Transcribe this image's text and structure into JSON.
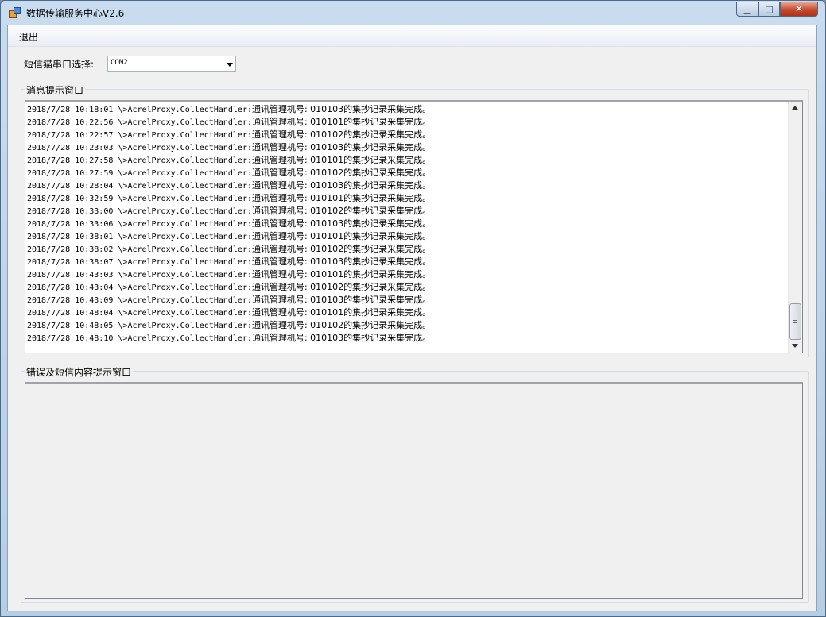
{
  "window": {
    "title": "数据传输服务中心V2.6",
    "controls": {
      "minimize": "▁",
      "maximize": "□",
      "close": "✕"
    }
  },
  "menu": {
    "exit": "退出"
  },
  "port": {
    "label": "短信猫串口选择:",
    "selected": "COM2"
  },
  "message_panel": {
    "title": "消息提示窗口",
    "lines": [
      {
        "time": "2018/7/28 10:18:01",
        "source": "\\>AcrelProxy.CollectHandler:",
        "msg": "通讯管理机号: 010103的集抄记录采集完成。"
      },
      {
        "time": "2018/7/28 10:22:56",
        "source": "\\>AcrelProxy.CollectHandler:",
        "msg": "通讯管理机号: 010101的集抄记录采集完成。"
      },
      {
        "time": "2018/7/28 10:22:57",
        "source": "\\>AcrelProxy.CollectHandler:",
        "msg": "通讯管理机号: 010102的集抄记录采集完成。"
      },
      {
        "time": "2018/7/28 10:23:03",
        "source": "\\>AcrelProxy.CollectHandler:",
        "msg": "通讯管理机号: 010103的集抄记录采集完成。"
      },
      {
        "time": "2018/7/28 10:27:58",
        "source": "\\>AcrelProxy.CollectHandler:",
        "msg": "通讯管理机号: 010101的集抄记录采集完成。"
      },
      {
        "time": "2018/7/28 10:27:59",
        "source": "\\>AcrelProxy.CollectHandler:",
        "msg": "通讯管理机号: 010102的集抄记录采集完成。"
      },
      {
        "time": "2018/7/28 10:28:04",
        "source": "\\>AcrelProxy.CollectHandler:",
        "msg": "通讯管理机号: 010103的集抄记录采集完成。"
      },
      {
        "time": "2018/7/28 10:32:59",
        "source": "\\>AcrelProxy.CollectHandler:",
        "msg": "通讯管理机号: 010101的集抄记录采集完成。"
      },
      {
        "time": "2018/7/28 10:33:00",
        "source": "\\>AcrelProxy.CollectHandler:",
        "msg": "通讯管理机号: 010102的集抄记录采集完成。"
      },
      {
        "time": "2018/7/28 10:33:06",
        "source": "\\>AcrelProxy.CollectHandler:",
        "msg": "通讯管理机号: 010103的集抄记录采集完成。"
      },
      {
        "time": "2018/7/28 10:38:01",
        "source": "\\>AcrelProxy.CollectHandler:",
        "msg": "通讯管理机号: 010101的集抄记录采集完成。"
      },
      {
        "time": "2018/7/28 10:38:02",
        "source": "\\>AcrelProxy.CollectHandler:",
        "msg": "通讯管理机号: 010102的集抄记录采集完成。"
      },
      {
        "time": "2018/7/28 10:38:07",
        "source": "\\>AcrelProxy.CollectHandler:",
        "msg": "通讯管理机号: 010103的集抄记录采集完成。"
      },
      {
        "time": "2018/7/28 10:43:03",
        "source": "\\>AcrelProxy.CollectHandler:",
        "msg": "通讯管理机号: 010101的集抄记录采集完成。"
      },
      {
        "time": "2018/7/28 10:43:04",
        "source": "\\>AcrelProxy.CollectHandler:",
        "msg": "通讯管理机号: 010102的集抄记录采集完成。"
      },
      {
        "time": "2018/7/28 10:43:09",
        "source": "\\>AcrelProxy.CollectHandler:",
        "msg": "通讯管理机号: 010103的集抄记录采集完成。"
      },
      {
        "time": "2018/7/28 10:48:04",
        "source": "\\>AcrelProxy.CollectHandler:",
        "msg": "通讯管理机号: 010101的集抄记录采集完成。"
      },
      {
        "time": "2018/7/28 10:48:05",
        "source": "\\>AcrelProxy.CollectHandler:",
        "msg": "通讯管理机号: 010102的集抄记录采集完成。"
      },
      {
        "time": "2018/7/28 10:48:10",
        "source": "\\>AcrelProxy.CollectHandler:",
        "msg": "通讯管理机号: 010103的集抄记录采集完成。"
      }
    ]
  },
  "error_panel": {
    "title": "错误及短信内容提示窗口"
  }
}
